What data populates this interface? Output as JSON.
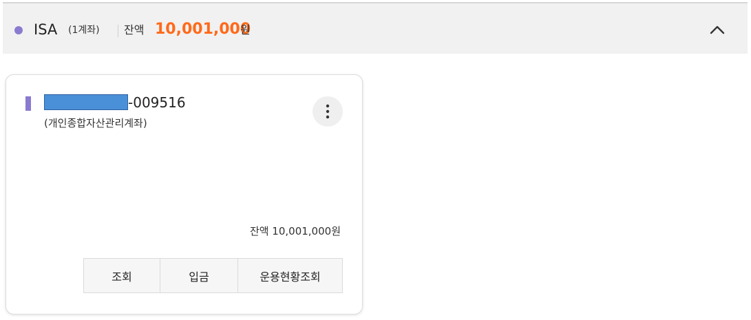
{
  "group": {
    "name": "ISA",
    "count_label": "(1계좌)",
    "balance_label": "잔액",
    "balance_amount": "10,001,000",
    "balance_unit": "원",
    "dot_color": "#8a7bd0",
    "amount_color": "#ff6a1a",
    "collapse_icon": "chevron-up-icon"
  },
  "account": {
    "number_suffix": "-009516",
    "type_label": "(개인종합자산관리계좌)",
    "balance_text": "잔액 10,001,000원",
    "more_icon": "more-vertical-icon",
    "actions": [
      "조회",
      "입금",
      "운용현황조회"
    ]
  }
}
